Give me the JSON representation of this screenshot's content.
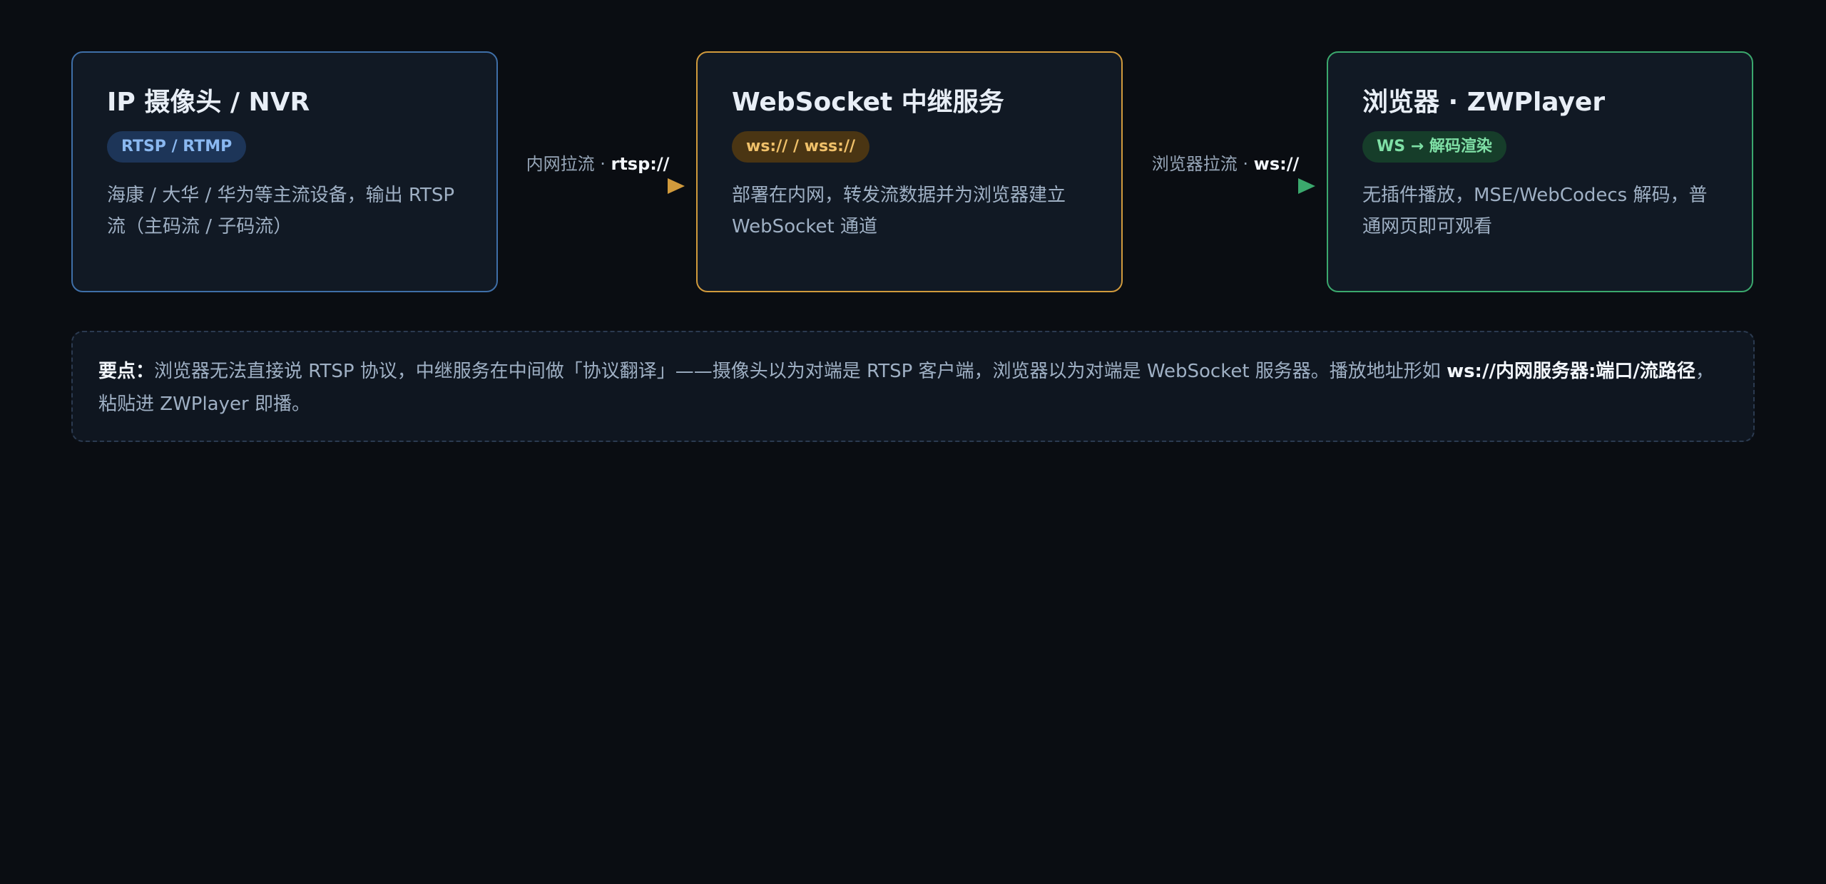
{
  "nodes": [
    {
      "title": "IP 摄像头 / NVR",
      "badge": "RTSP / RTMP",
      "description": "海康 / 大华 / 华为等主流设备，输出 RTSP 流（主码流 / 子码流）",
      "color": "#3f6fa8"
    },
    {
      "title": "WebSocket 中继服务",
      "badge": "ws:// / wss://",
      "description": "部署在内网，转发流数据并为浏览器建立 WebSocket 通道",
      "color": "#d19a3c"
    },
    {
      "title": "浏览器 · ZWPlayer",
      "badge": "WS → 解码渲染",
      "description": "无插件播放，MSE/WebCodecs 解码，普通网页即可观看",
      "color": "#3ba86d"
    }
  ],
  "edges": [
    {
      "label": "内网拉流 · ",
      "protocol": "rtsp://"
    },
    {
      "label": "浏览器拉流 · ",
      "protocol": "ws://"
    }
  ],
  "note": {
    "lead": "要点：",
    "text": "浏览器无法直接说 RTSP 协议，中继服务在中间做「协议翻译」——摄像头以为对端是 RTSP 客户端，浏览器以为对端是 WebSocket 服务器。播放地址形如 ",
    "address": "ws://内网服务器:端口/流路径",
    "tail": "，粘贴进 ZWPlayer 即播。"
  }
}
